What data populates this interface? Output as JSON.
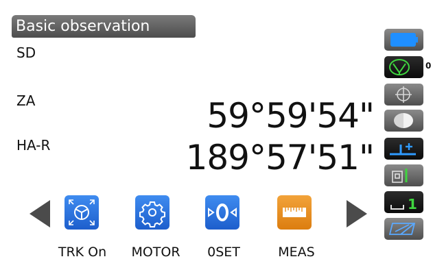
{
  "screen": {
    "title": "Basic observation"
  },
  "measurements": {
    "sd_label": "SD",
    "za_label": "ZA",
    "za_value": "59°59'54\"",
    "har_label": "HA-R",
    "har_value": "189°57'51\""
  },
  "softkeys": {
    "trk_label": "TRK On",
    "motor_label": "MOTOR",
    "oset_label": "0SET",
    "meas_label": "MEAS"
  },
  "status_bar": {
    "prism_count": "0",
    "face_number": "1",
    "icons": [
      "battery-icon",
      "prism-target-icon",
      "crosshair-icon",
      "half-moon-icon",
      "plus-icon",
      "laser-pointer-icon",
      "face-number-icon",
      "keyboard-toggle-icon"
    ]
  },
  "colors": {
    "blue_key": "#2f74e0",
    "orange_key": "#e8901f",
    "title_bg": "#5e5e5e",
    "side_button_bg": "#6a6a6a",
    "green_icon": "#3fd53f",
    "battery_blue": "#1f8fff"
  }
}
